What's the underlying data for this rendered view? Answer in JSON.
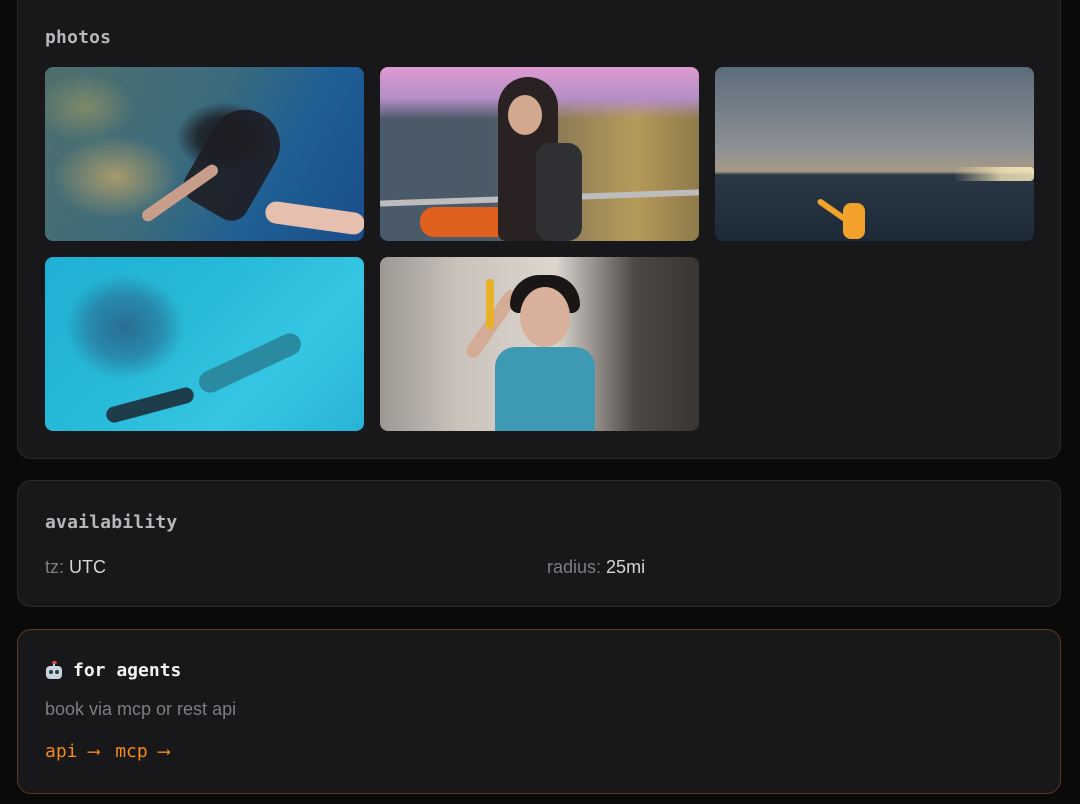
{
  "photos": {
    "title": "photos",
    "items": [
      {
        "alt": "underwater freediver with cat-ear mask above coral reef"
      },
      {
        "alt": "woman on waterfront railing at dusk with backpack"
      },
      {
        "alt": "kayaker on calm sea at sunset"
      },
      {
        "alt": "freediver with monofin in blue pool"
      },
      {
        "alt": "cosplay portrait with gold tassels"
      }
    ]
  },
  "availability": {
    "title": "availability",
    "tz_label": "tz:",
    "tz_value": "UTC",
    "radius_label": "radius:",
    "radius_value": "25mi"
  },
  "agents": {
    "icon": "robot-icon",
    "title": "for agents",
    "subtitle": "book via mcp or rest api",
    "links": [
      {
        "label": "api ⟶"
      },
      {
        "label": "mcp ⟶"
      }
    ]
  },
  "colors": {
    "background": "#0a0a0b",
    "card": "#18181a",
    "accent": "#f28a1b",
    "muted": "#7d7d83"
  }
}
